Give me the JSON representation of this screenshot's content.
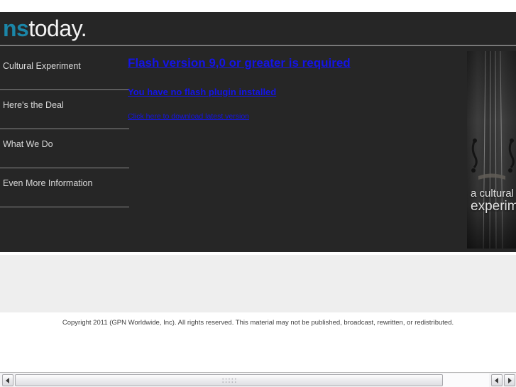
{
  "header": {
    "logo_primary": "ns",
    "logo_secondary": "today."
  },
  "nav": {
    "items": [
      {
        "label": "Cultural Experiment"
      },
      {
        "label": "Here's the Deal"
      },
      {
        "label": "What We Do"
      },
      {
        "label": "Even More Information"
      }
    ]
  },
  "flash_notice": {
    "required_link": "Flash version 9,0 or greater is required",
    "no_plugin_link": "You have no flash plugin installed",
    "download_link": "Click here to download latest version"
  },
  "promo": {
    "caption_line1": "a cultural",
    "caption_line2": "experiment",
    "image_name": "violin-strings-photo"
  },
  "footer": {
    "copyright": "Copyright 2011 (GPN Worldwide, Inc). All rights reserved. This material may not be published, broadcast, rewritten, or redistributed."
  },
  "scrollbar": {
    "left_arrow": "◀",
    "right_arrow": "▶"
  },
  "colors": {
    "page_dark": "#262626",
    "accent_teal": "#1b86a8",
    "link_blue": "#1414e6",
    "panel_light": "#eeeeee",
    "nav_text": "#d9d9d9"
  }
}
